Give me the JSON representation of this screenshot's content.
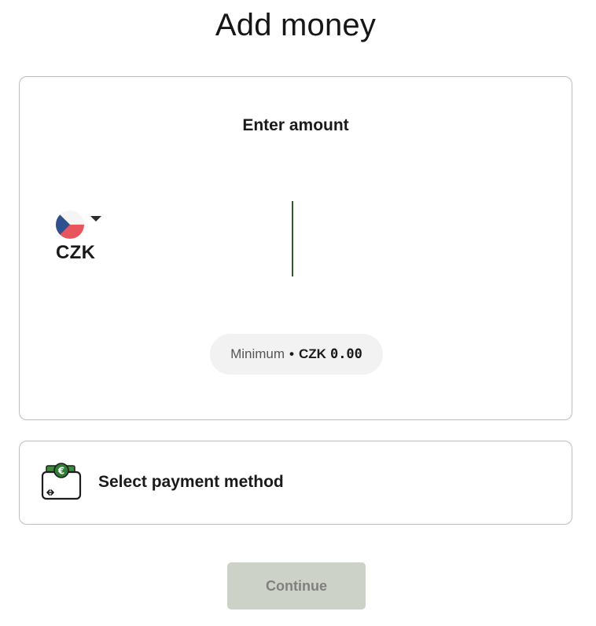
{
  "page": {
    "title": "Add money"
  },
  "amount_card": {
    "heading": "Enter amount",
    "currency": {
      "code": "CZK",
      "flag_icon": "czech-flag-icon",
      "dropdown_icon": "chevron-down-icon"
    },
    "amount_value": "",
    "minimum": {
      "label": "Minimum",
      "separator": "•",
      "currency": "CZK",
      "value": "0.00"
    }
  },
  "payment": {
    "label": "Select payment method",
    "icon": "wallet-euro-icon"
  },
  "actions": {
    "continue_label": "Continue",
    "continue_enabled": false
  },
  "colors": {
    "card_border": "#bdbdbd",
    "caret": "#2f5a34",
    "pill_bg": "#f2f2f2",
    "button_disabled_bg": "#cdd2c8",
    "button_disabled_text": "#808080",
    "accent_green": "#2e7d32"
  }
}
